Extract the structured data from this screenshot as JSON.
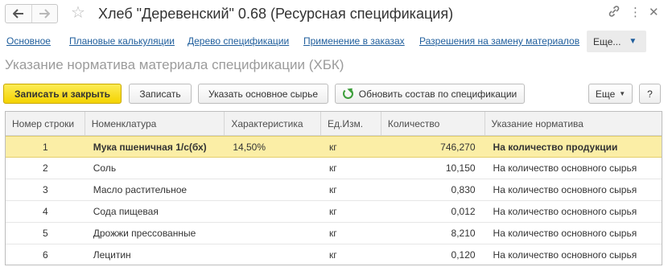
{
  "window": {
    "title": "Хлеб \"Деревенский\" 0.68 (Ресурсная спецификация)",
    "back_icon": "arrow-left-icon",
    "forward_icon": "arrow-right-icon",
    "favorite_icon": "star-icon",
    "close_icon": "close-icon",
    "link_icon": "link-icon",
    "more_icon": "kebab-menu-icon"
  },
  "links": {
    "items": [
      "Основное",
      "Плановые калькуляции",
      "Дерево спецификации",
      "Применение в заказах",
      "Разрешения на замену материалов"
    ],
    "more_label": "Еще..."
  },
  "form": {
    "title": "Указание норматива материала спецификации (ХБК)"
  },
  "toolbar": {
    "save_close_label": "Записать и закрыть",
    "save_label": "Записать",
    "set_main_label": "Указать основное сырье",
    "refresh_label": "Обновить состав по спецификации",
    "more_label": "Еще",
    "help_label": "?"
  },
  "table": {
    "columns": [
      "Номер строки",
      "Номенклатура",
      "Характеристика",
      "Ед.Изм.",
      "Количество",
      "Указание норматива"
    ],
    "rows": [
      {
        "n": "1",
        "item": "Мука пшеничная 1/с(бх)",
        "char": "14,50%",
        "unit": "кг",
        "qty": "746,270",
        "norm": "На количество продукции",
        "selected": true
      },
      {
        "n": "2",
        "item": "Соль",
        "char": "",
        "unit": "кг",
        "qty": "10,150",
        "norm": "На количество основного сырья",
        "selected": false
      },
      {
        "n": "3",
        "item": "Масло растительное",
        "char": "",
        "unit": "кг",
        "qty": "0,830",
        "norm": "На количество основного сырья",
        "selected": false
      },
      {
        "n": "4",
        "item": "Сода пищевая",
        "char": "",
        "unit": "кг",
        "qty": "0,012",
        "norm": "На количество основного сырья",
        "selected": false
      },
      {
        "n": "5",
        "item": "Дрожжи прессованные",
        "char": "",
        "unit": "кг",
        "qty": "8,210",
        "norm": "На количество основного сырья",
        "selected": false
      },
      {
        "n": "6",
        "item": "Лецитин",
        "char": "",
        "unit": "кг",
        "qty": "0,120",
        "norm": "На количество основного сырья",
        "selected": false
      }
    ]
  },
  "colors": {
    "primary_button": "#f4d300",
    "selected_row": "#fbeea6",
    "link": "#1f5e9c",
    "refresh_icon": "#3c9e3a"
  }
}
